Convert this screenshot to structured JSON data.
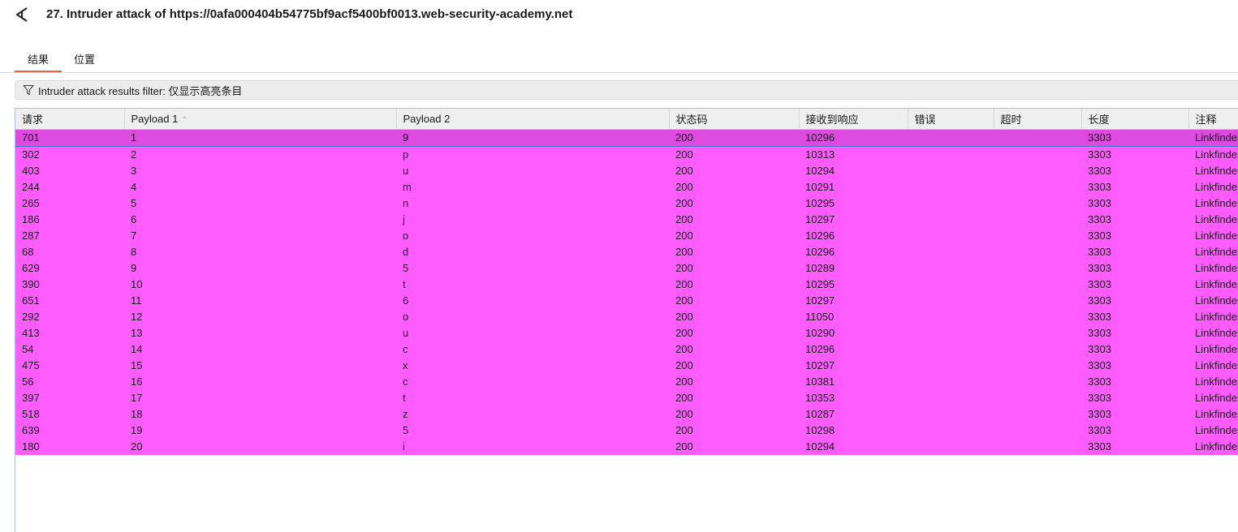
{
  "window": {
    "title": "27. Intruder attack of https://0afa000404b54775bf9acf5400bf0013.web-security-academy.net"
  },
  "tabs": [
    {
      "label": "结果",
      "active": true
    },
    {
      "label": "位置",
      "active": false
    }
  ],
  "filter": {
    "text": "Intruder attack results filter: 仅显示高亮条目"
  },
  "colors": {
    "highlight_row": "#ff5cff",
    "selected_row": "#dc4ae0",
    "active_tab_underline": "#e8643c"
  },
  "table": {
    "columns": [
      "请求",
      "Payload 1",
      "Payload 2",
      "状态码",
      "接收到响应",
      "错误",
      "超时",
      "长度",
      "注释"
    ],
    "sorted_column": "Payload 1",
    "sort_direction": "ascending",
    "rows": [
      [
        "701",
        "1",
        "9",
        "200",
        "10296",
        "",
        "",
        "3303",
        "Linkfinder"
      ],
      [
        "302",
        "2",
        "p",
        "200",
        "10313",
        "",
        "",
        "3303",
        "Linkfinder"
      ],
      [
        "403",
        "3",
        "u",
        "200",
        "10294",
        "",
        "",
        "3303",
        "Linkfinder"
      ],
      [
        "244",
        "4",
        "m",
        "200",
        "10291",
        "",
        "",
        "3303",
        "Linkfinder"
      ],
      [
        "265",
        "5",
        "n",
        "200",
        "10295",
        "",
        "",
        "3303",
        "Linkfinder"
      ],
      [
        "186",
        "6",
        "j",
        "200",
        "10297",
        "",
        "",
        "3303",
        "Linkfinder"
      ],
      [
        "287",
        "7",
        "o",
        "200",
        "10296",
        "",
        "",
        "3303",
        "Linkfinder"
      ],
      [
        "68",
        "8",
        "d",
        "200",
        "10296",
        "",
        "",
        "3303",
        "Linkfinder"
      ],
      [
        "629",
        "9",
        "5",
        "200",
        "10289",
        "",
        "",
        "3303",
        "Linkfinder"
      ],
      [
        "390",
        "10",
        "t",
        "200",
        "10295",
        "",
        "",
        "3303",
        "Linkfinder"
      ],
      [
        "651",
        "11",
        "6",
        "200",
        "10297",
        "",
        "",
        "3303",
        "Linkfinder"
      ],
      [
        "292",
        "12",
        "o",
        "200",
        "11050",
        "",
        "",
        "3303",
        "Linkfinder"
      ],
      [
        "413",
        "13",
        "u",
        "200",
        "10290",
        "",
        "",
        "3303",
        "Linkfinder"
      ],
      [
        "54",
        "14",
        "c",
        "200",
        "10296",
        "",
        "",
        "3303",
        "Linkfinder"
      ],
      [
        "475",
        "15",
        "x",
        "200",
        "10297",
        "",
        "",
        "3303",
        "Linkfinder"
      ],
      [
        "56",
        "16",
        "c",
        "200",
        "10381",
        "",
        "",
        "3303",
        "Linkfinder"
      ],
      [
        "397",
        "17",
        "t",
        "200",
        "10353",
        "",
        "",
        "3303",
        "Linkfinder"
      ],
      [
        "518",
        "18",
        "z",
        "200",
        "10287",
        "",
        "",
        "3303",
        "Linkfinder"
      ],
      [
        "639",
        "19",
        "5",
        "200",
        "10298",
        "",
        "",
        "3303",
        "Linkfinder"
      ],
      [
        "180",
        "20",
        "i",
        "200",
        "10294",
        "",
        "",
        "3303",
        "Linkfinder"
      ]
    ]
  }
}
